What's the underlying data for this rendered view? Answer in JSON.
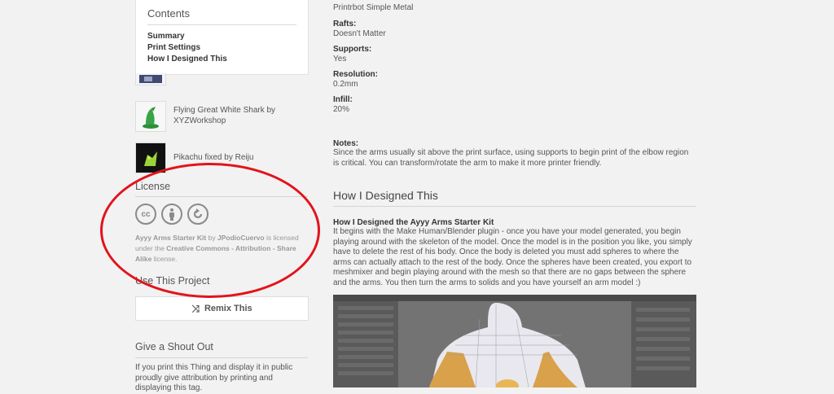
{
  "contents": {
    "title": "Contents",
    "links": [
      "Summary",
      "Print Settings",
      "How I Designed This"
    ]
  },
  "remixes": [
    {
      "label": "Flying Great White Shark by XYZWorkshop"
    },
    {
      "label": "Pikachu fixed by Reiju"
    }
  ],
  "license": {
    "title": "License",
    "thing_name": "Ayyy Arms Starter Kit",
    "by": "by",
    "author": "JPodioCuervo",
    "is_licensed": "is licensed under the",
    "license_name": "Creative Commons - Attribution - Share Alike",
    "license_suffix": "license.",
    "icons": [
      "cc",
      "by",
      "sa"
    ]
  },
  "use_project": {
    "title": "Use This Project",
    "remix_label": "Remix This"
  },
  "shout": {
    "title": "Give a Shout Out",
    "text": "If you print this Thing and display it in public proudly give attribution by printing and displaying this tag."
  },
  "settings": {
    "printer_value": "Printrbot Simple Metal",
    "items": [
      {
        "label": "Rafts:",
        "value": "Doesn't Matter"
      },
      {
        "label": "Supports:",
        "value": "Yes"
      },
      {
        "label": "Resolution:",
        "value": "0.2mm"
      },
      {
        "label": "Infill:",
        "value": "20%"
      }
    ],
    "notes_label": "Notes:",
    "notes_text": "Since the arms usually sit above the print surface, using supports to begin print of the elbow region is critical. You can transform/rotate the arm to make it more printer friendly."
  },
  "designed": {
    "title": "How I Designed This",
    "subtitle": "How I Designed the Ayyy Arms Starter Kit",
    "text": "It begins with the Make Human/Blender plugin - once you have your model generated, you begin playing around with the skeleton of the model. Once the model is in the position you like, you simply have to delete the rest of his body. Once the body is deleted you must add spheres to where the arms can actually attach to the rest of the body. Once the spheres have been created, you export to meshmixer and begin playing around with the mesh so that there are no gaps between the sphere and the arms. You then turn the arms to solids and you have yourself an arm model :)"
  },
  "colors": {
    "annotation_circle": "#e3131b",
    "background": "#f2f2f2"
  }
}
